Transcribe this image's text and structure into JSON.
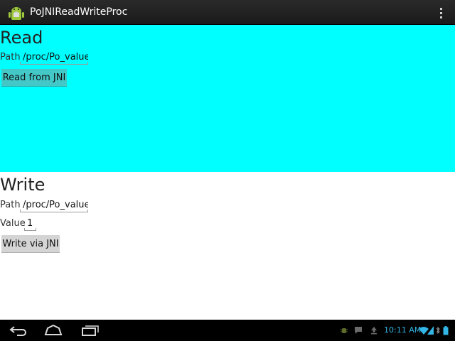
{
  "app": {
    "title": "PoJNIReadWriteProc"
  },
  "read": {
    "title": "Read",
    "path_label": "Path",
    "path_value": "/proc/Po_value",
    "button_label": "Read from JNI",
    "background": "#00ffff"
  },
  "write": {
    "title": "Write",
    "path_label": "Path",
    "path_value": "/proc/Po_value",
    "value_label": "Value",
    "value_value": "1",
    "button_label": "Write via JNI"
  },
  "navbar": {
    "icons": [
      "back-icon",
      "home-icon",
      "recent-apps-icon"
    ]
  },
  "status": {
    "time": "10:11 AM",
    "icons": [
      "debug-icon",
      "notification-icon",
      "upload-icon",
      "wifi-icon",
      "bluetooth-icon",
      "battery-icon"
    ],
    "accent": "#33b5e5"
  }
}
